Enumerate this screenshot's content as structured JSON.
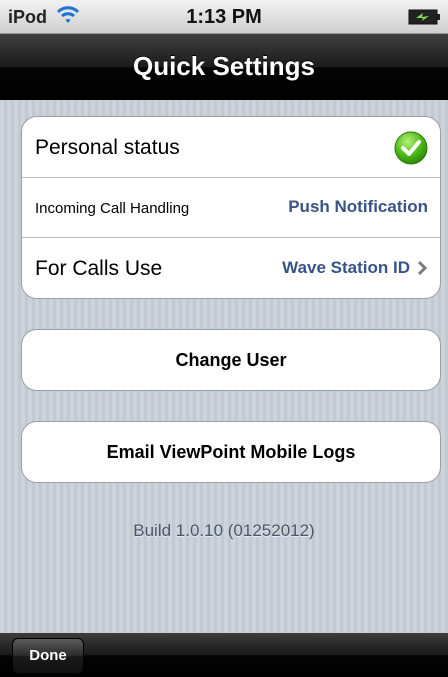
{
  "status_bar": {
    "carrier": "iPod",
    "time": "1:13 PM"
  },
  "nav": {
    "title": "Quick Settings"
  },
  "settings": {
    "personal_status_label": "Personal status",
    "incoming_call_label": "Incoming Call Handling",
    "incoming_call_value": "Push Notification",
    "calls_use_label": "For Calls Use",
    "calls_use_value": "Wave Station ID"
  },
  "buttons": {
    "change_user": "Change User",
    "email_logs": "Email ViewPoint Mobile Logs"
  },
  "build": "Build 1.0.10 (01252012)",
  "toolbar": {
    "done": "Done"
  },
  "icons": {
    "status": "checkmark-icon",
    "disclosure": "chevron-right-icon",
    "wifi": "wifi-icon",
    "battery": "battery-icon"
  },
  "colors": {
    "accent_value": "#385487",
    "status_ok": "#4cbb17"
  }
}
